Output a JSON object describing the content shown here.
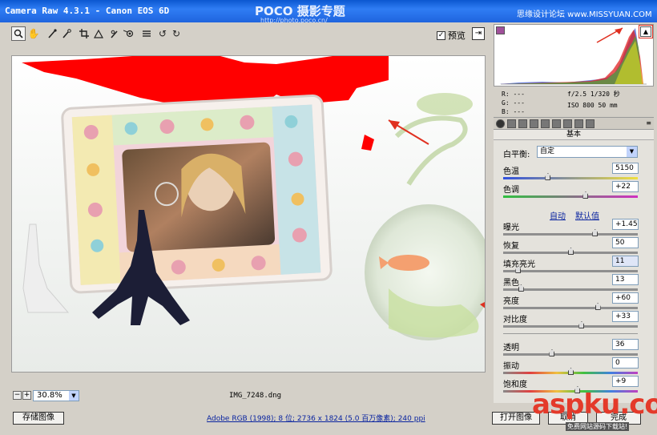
{
  "window": {
    "title": "Camera Raw 4.3.1 -  Canon EOS 6D",
    "watermark_logo": "POCO 摄影专题",
    "watermark_url": "http://photo.poco.cn/",
    "forum_mark": "思缘设计论坛 www.MISSYUAN.COM"
  },
  "toolbar": {
    "tools": [
      "zoom-icon",
      "hand-icon",
      "white-balance-icon",
      "color-sampler-icon",
      "crop-icon",
      "straighten-icon",
      "retouch-icon",
      "red-eye-icon",
      "list-icon",
      "rotate-left-icon",
      "rotate-right-icon"
    ],
    "preview_label": "预览",
    "preview_checked": true
  },
  "statusbar": {
    "zoom": "30.8%",
    "filename": "IMG_7248.dng"
  },
  "histogram": {
    "clip_color": "#ff0000"
  },
  "readout": {
    "r": "R:  ---",
    "g": "G:  ---",
    "b": "B:  ---",
    "exposure": "f/2.5  1/320 秒",
    "iso": "ISO 800  50 mm"
  },
  "panel": {
    "title": "基本",
    "white_balance_label": "白平衡:",
    "white_balance_value": "自定",
    "temperature": {
      "label": "色温",
      "value": "5150",
      "level": 0.33
    },
    "tint": {
      "label": "色调",
      "value": "+22",
      "level": 0.61
    },
    "auto_link": "自动",
    "default_link": "默认值",
    "exposure": {
      "label": "曝光",
      "value": "+1.45",
      "level": 0.68
    },
    "recovery": {
      "label": "恢复",
      "value": "50",
      "level": 0.5
    },
    "fill_light": {
      "label": "填充亮光",
      "value": "11",
      "level": 0.11
    },
    "blacks": {
      "label": "黑色",
      "value": "13",
      "level": 0.13
    },
    "brightness": {
      "label": "亮度",
      "value": "+60",
      "level": 0.7
    },
    "contrast": {
      "label": "对比度",
      "value": "+33",
      "level": 0.58
    },
    "clarity": {
      "label": "透明",
      "value": "36",
      "level": 0.36
    },
    "vibrance": {
      "label": "振动",
      "value": "0",
      "level": 0.5
    },
    "saturation": {
      "label": "饱和度",
      "value": "+9",
      "level": 0.55
    }
  },
  "bottom": {
    "save_label": "存储图像",
    "info": "Adobe RGB (1998); 8 位; 2736 x 1824 (5.0 百万像素); 240 ppi",
    "open_label": "打开图像",
    "cancel_label": "取消",
    "done_label": "完成",
    "aspku_logo": "aspku.com",
    "aspku_caption": "免费网站源码下载站!"
  }
}
